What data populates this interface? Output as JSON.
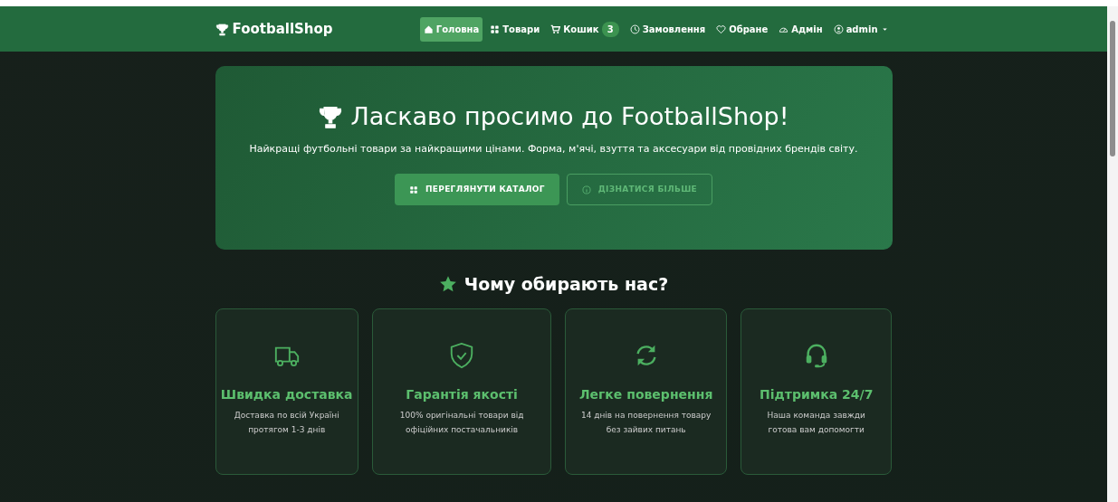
{
  "navbar": {
    "brand": "FootballShop",
    "items": [
      {
        "kind": "home",
        "label": "Головна",
        "selected": true
      },
      {
        "kind": "catalog",
        "label": "Товари",
        "selected": false
      },
      {
        "kind": "cart",
        "label": "Кошик",
        "badge": "3",
        "selected": false
      },
      {
        "kind": "orders",
        "label": "Замовлення",
        "selected": false
      },
      {
        "kind": "favorites",
        "label": "Обране",
        "selected": false
      },
      {
        "kind": "admin",
        "label": "Адмін",
        "selected": false
      },
      {
        "kind": "account",
        "label": "admin",
        "dropdown": true,
        "selected": false
      }
    ]
  },
  "hero": {
    "title": "Ласкаво просимо до FootballShop!",
    "subtitle": "Найкращі футбольні товари за найкращими цінами. Форма, м'ячі, взуття та аксесуари від провідних брендів світу.",
    "buttons": [
      {
        "kind": "primary",
        "label": "ПЕРЕГЛЯНУТИ КАТАЛОГ"
      },
      {
        "kind": "outline",
        "label": "ДІЗНАТИСЯ БІЛЬШЕ"
      }
    ]
  },
  "features": {
    "title": "Чому обирають нас?",
    "cards": [
      {
        "kind": "delivery",
        "title": "Швидка доставка",
        "text": "Доставка по всій Україні протягом 1-3 днів"
      },
      {
        "kind": "quality",
        "title": "Гарантія якості",
        "text": "100% оригінальні товари від офіційних постачальників"
      },
      {
        "kind": "returns",
        "title": "Легке повернення",
        "text": "14 днів на повернення товару без зайвих питань"
      },
      {
        "kind": "support",
        "title": "Підтримка 24/7",
        "text": "Наша команда завжди готова вам допомогти"
      }
    ]
  }
}
